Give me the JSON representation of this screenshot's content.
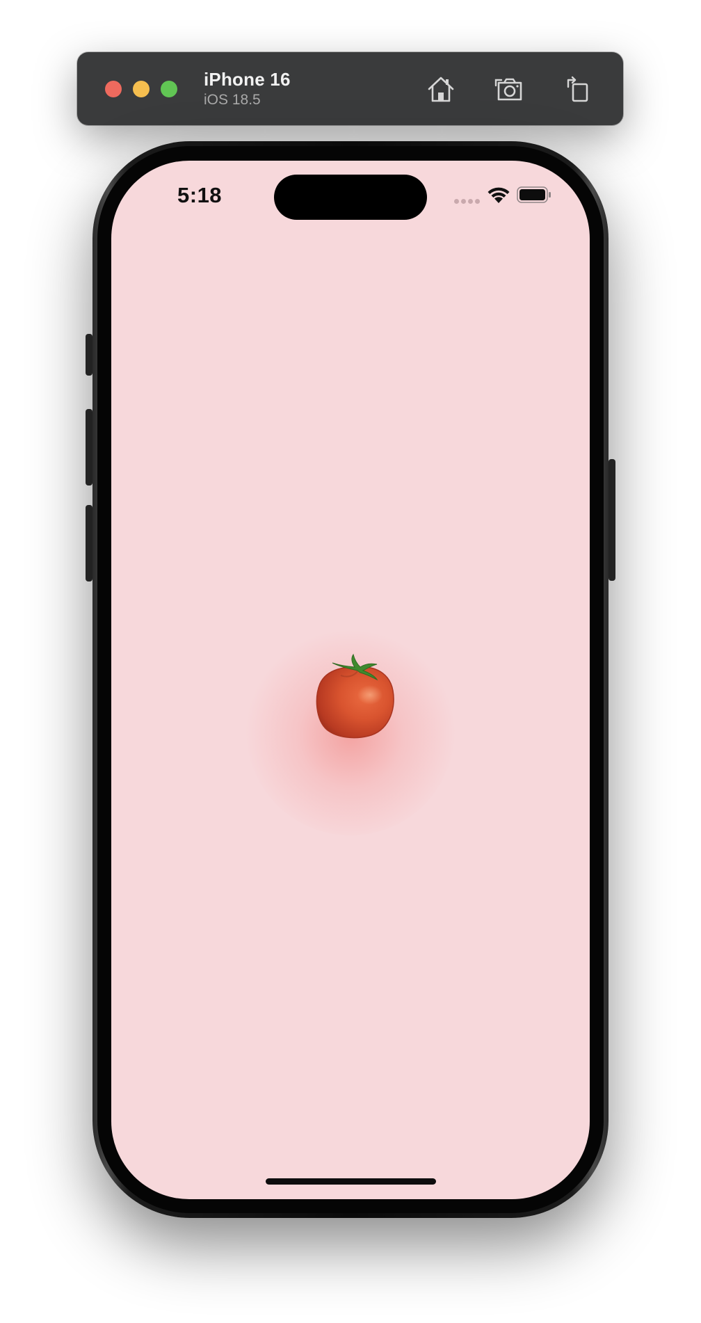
{
  "toolbar": {
    "device_name": "iPhone 16",
    "os_version": "iOS 18.5",
    "buttons": {
      "home": "home-icon",
      "screenshot": "camera-icon",
      "rotate": "rotate-icon"
    },
    "window_controls": {
      "close_color": "#ee6a5e",
      "minimize_color": "#f5be4f",
      "zoom_color": "#61c554"
    }
  },
  "status_bar": {
    "time": "5:18",
    "icons": [
      "cellular-signal-icon",
      "wifi-icon",
      "battery-icon"
    ]
  },
  "screen": {
    "background_color": "#f7d8db",
    "content": "tomato-icon"
  }
}
